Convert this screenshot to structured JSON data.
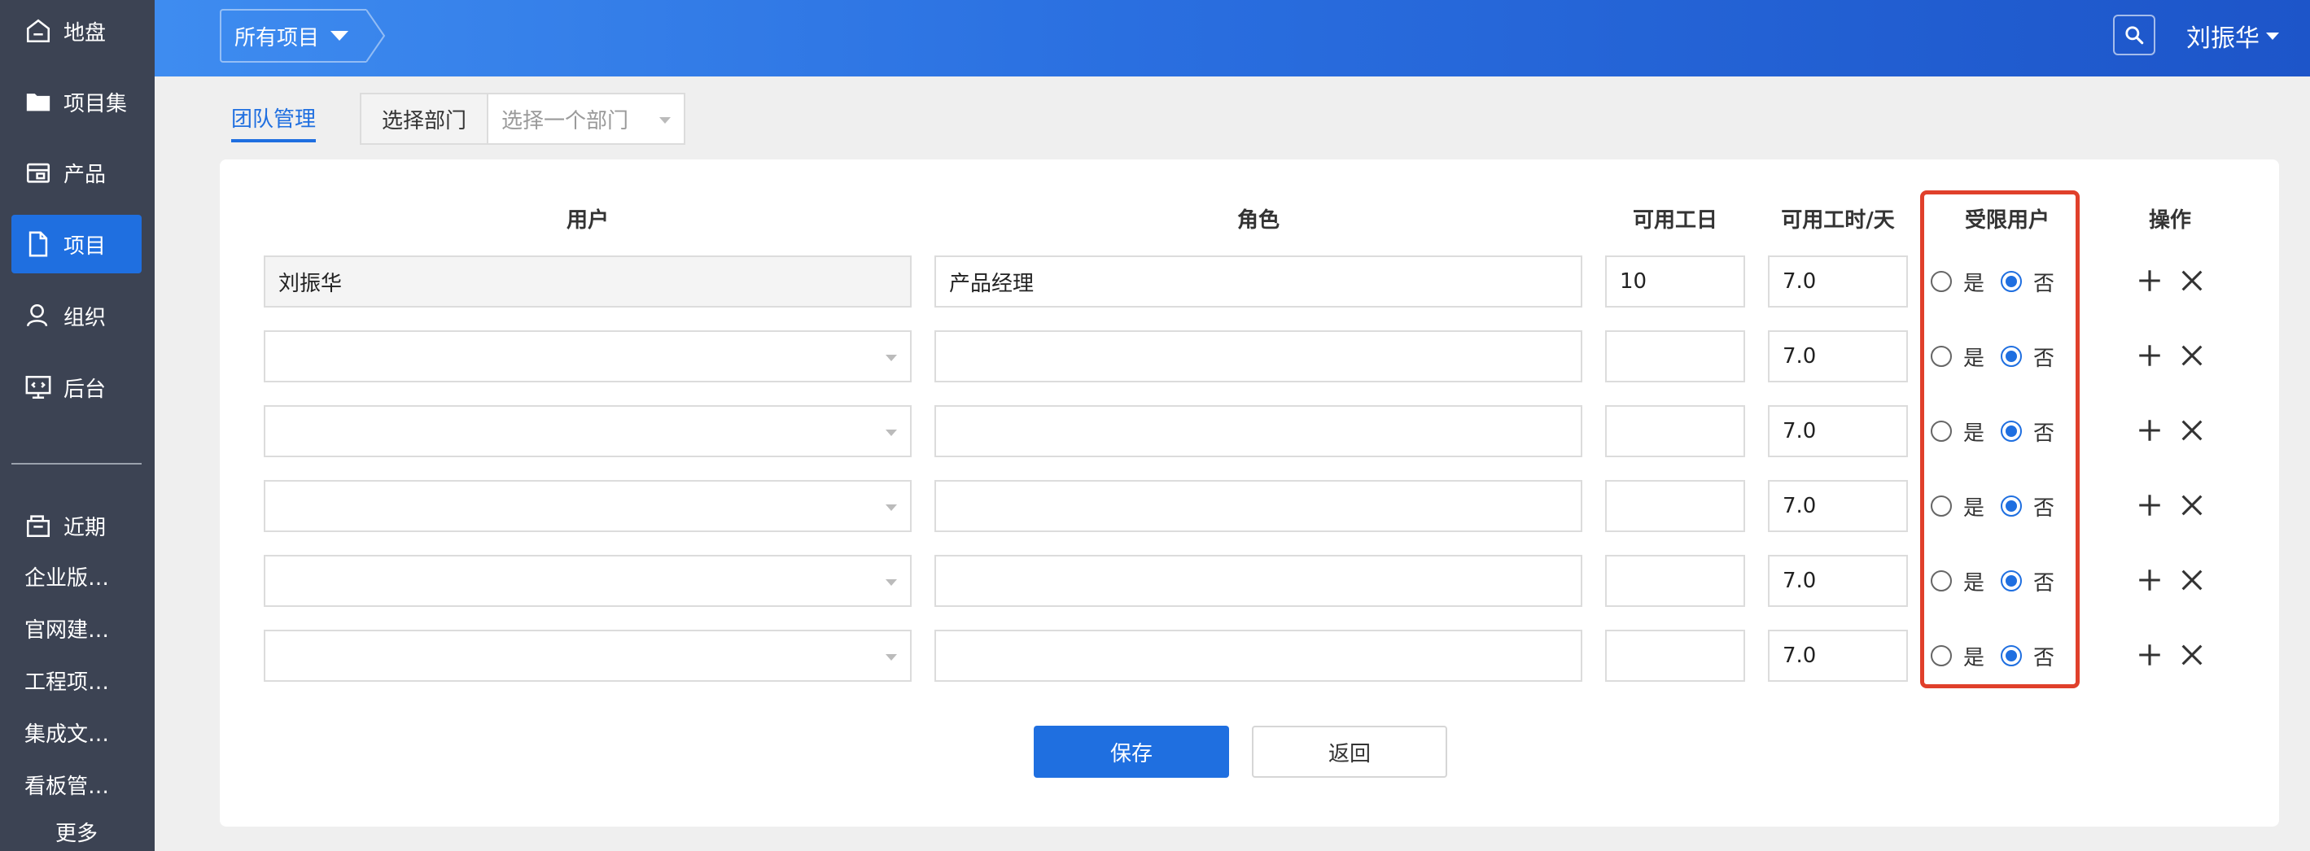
{
  "sidebar": {
    "nav": [
      {
        "label": "地盘",
        "icon": "home-icon"
      },
      {
        "label": "项目集",
        "icon": "folder-icon"
      },
      {
        "label": "产品",
        "icon": "product-icon"
      },
      {
        "label": "项目",
        "icon": "document-icon"
      },
      {
        "label": "组织",
        "icon": "user-icon"
      },
      {
        "label": "后台",
        "icon": "monitor-icon"
      }
    ],
    "recent_label": "近期",
    "recent_items": [
      "企业版…",
      "官网建…",
      "工程项…",
      "集成文…",
      "看板管…"
    ],
    "more_label": "更多"
  },
  "header": {
    "breadcrumb": "所有项目",
    "user_name": "刘振华"
  },
  "toolbar": {
    "tab_team": "团队管理",
    "dept_label": "选择部门",
    "dept_placeholder": "选择一个部门"
  },
  "table": {
    "headers": {
      "user": "用户",
      "role": "角色",
      "days": "可用工日",
      "hours": "可用工时/天",
      "limited": "受限用户",
      "ops": "操作"
    },
    "radio_yes": "是",
    "radio_no": "否",
    "rows": [
      {
        "user": "刘振华",
        "role": "产品经理",
        "days": "10",
        "hours": "7.0",
        "limited": "否"
      },
      {
        "user": "",
        "role": "",
        "days": "",
        "hours": "7.0",
        "limited": "否"
      },
      {
        "user": "",
        "role": "",
        "days": "",
        "hours": "7.0",
        "limited": "否"
      },
      {
        "user": "",
        "role": "",
        "days": "",
        "hours": "7.0",
        "limited": "否"
      },
      {
        "user": "",
        "role": "",
        "days": "",
        "hours": "7.0",
        "limited": "否"
      },
      {
        "user": "",
        "role": "",
        "days": "",
        "hours": "7.0",
        "limited": "否"
      }
    ]
  },
  "actions": {
    "save": "保存",
    "back": "返回"
  },
  "colors": {
    "accent": "#1f6fe0",
    "sidebar": "#3c4353",
    "highlight": "#e0402b"
  }
}
